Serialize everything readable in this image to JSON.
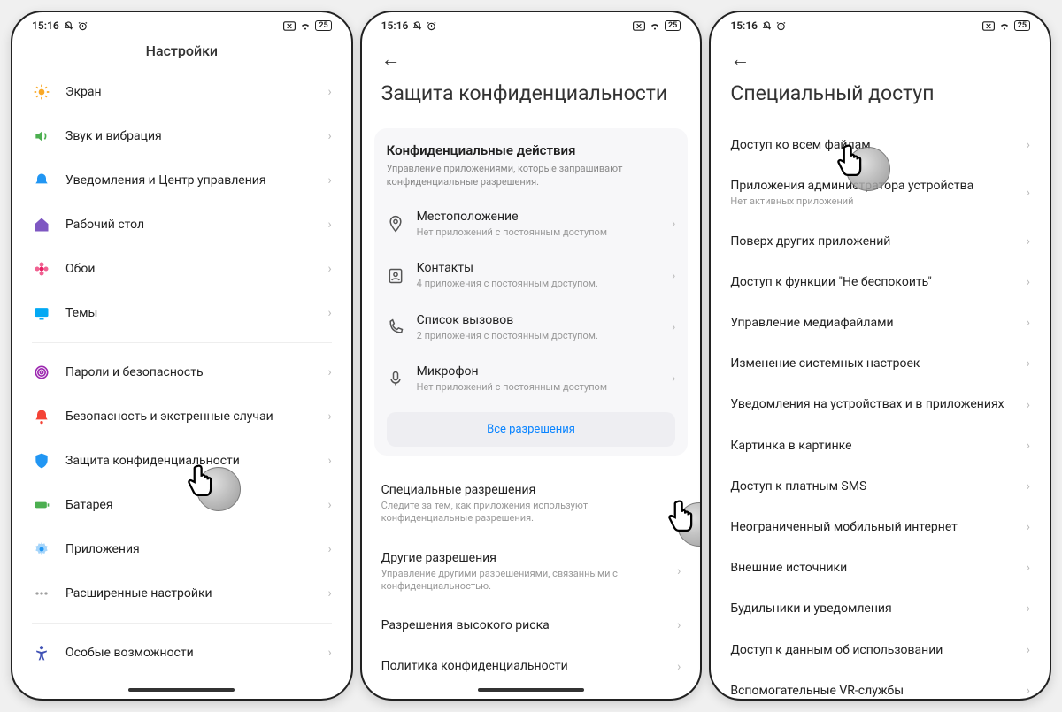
{
  "status": {
    "time": "15:16",
    "battery": "25"
  },
  "screen1": {
    "title": "Настройки",
    "group1": [
      {
        "label": "Экран",
        "icon": "sun",
        "key": "screen"
      },
      {
        "label": "Звук и вибрация",
        "icon": "speaker",
        "key": "sound"
      },
      {
        "label": "Уведомления и Центр управления",
        "icon": "bell",
        "key": "notifications"
      },
      {
        "label": "Рабочий стол",
        "icon": "home",
        "key": "home"
      },
      {
        "label": "Обои",
        "icon": "flower",
        "key": "wallpaper"
      },
      {
        "label": "Темы",
        "icon": "monitor",
        "key": "themes"
      }
    ],
    "group2": [
      {
        "label": "Пароли и безопасность",
        "icon": "fingerprint",
        "key": "passwords"
      },
      {
        "label": "Безопасность и экстренные случаи",
        "icon": "alert",
        "key": "safety"
      },
      {
        "label": "Защита конфиденциальности",
        "icon": "shield",
        "key": "privacy"
      },
      {
        "label": "Батарея",
        "icon": "battery",
        "key": "battery"
      },
      {
        "label": "Приложения",
        "icon": "gear",
        "key": "apps"
      },
      {
        "label": "Расширенные настройки",
        "icon": "dots",
        "key": "advanced"
      }
    ],
    "group3": [
      {
        "label": "Особые возможности",
        "icon": "accessibility",
        "key": "accessibility"
      }
    ]
  },
  "screen2": {
    "title": "Защита конфиденциальности",
    "card": {
      "title": "Конфиденциальные действия",
      "sub": "Управление приложениями, которые запрашивают конфиденциальные разрешения.",
      "rows": [
        {
          "label": "Местоположение",
          "sub": "Нет приложений с постоянным доступом",
          "icon": "pin"
        },
        {
          "label": "Контакты",
          "sub": "4 приложения с постоянным доступом.",
          "icon": "contacts"
        },
        {
          "label": "Список вызовов",
          "sub": "2 приложения с постоянным доступом.",
          "icon": "phone"
        },
        {
          "label": "Микрофон",
          "sub": "Нет приложений с постоянным доступом",
          "icon": "mic"
        }
      ],
      "all": "Все разрешения"
    },
    "rows": [
      {
        "label": "Специальные разрешения",
        "sub": "Следите за тем, как приложения используют конфиденциальные разрешения."
      },
      {
        "label": "Другие разрешения",
        "sub": "Управление другими разрешениями, связанными с конфиденциальностью."
      },
      {
        "label": "Разрешения высокого риска",
        "sub": ""
      },
      {
        "label": "Политика конфиденциальности",
        "sub": ""
      }
    ]
  },
  "screen3": {
    "title": "Специальный доступ",
    "rows": [
      {
        "label": "Доступ ко всем файлам",
        "sub": ""
      },
      {
        "label": "Приложения администратора устройства",
        "sub": "Нет активных приложений"
      },
      {
        "label": "Поверх других приложений",
        "sub": ""
      },
      {
        "label": "Доступ к функции \"Не беспокоить\"",
        "sub": ""
      },
      {
        "label": "Управление медиафайлами",
        "sub": ""
      },
      {
        "label": "Изменение системных настроек",
        "sub": ""
      },
      {
        "label": "Уведомления на устройствах и в приложениях",
        "sub": ""
      },
      {
        "label": "Картинка в картинке",
        "sub": ""
      },
      {
        "label": "Доступ к платным SMS",
        "sub": ""
      },
      {
        "label": "Неограниченный мобильный интернет",
        "sub": ""
      },
      {
        "label": "Внешние источники",
        "sub": ""
      },
      {
        "label": "Будильники и уведомления",
        "sub": ""
      },
      {
        "label": "Доступ к данным об использовании",
        "sub": ""
      },
      {
        "label": "Вспомогательные VR-службы",
        "sub": ""
      }
    ]
  },
  "iconColors": {
    "sun": "#f9a825",
    "speaker": "#4caf50",
    "bell": "#2196f3",
    "home": "#7e57c2",
    "flower": "#e91e63",
    "monitor": "#03a9f4",
    "fingerprint": "#9c27b0",
    "alert": "#f44336",
    "shield": "#2196f3",
    "battery": "#4caf50",
    "gear": "#2196f3",
    "dots": "#9e9e9e",
    "accessibility": "#3f51b5",
    "pin": "#555",
    "contacts": "#555",
    "phone": "#555",
    "mic": "#555"
  }
}
